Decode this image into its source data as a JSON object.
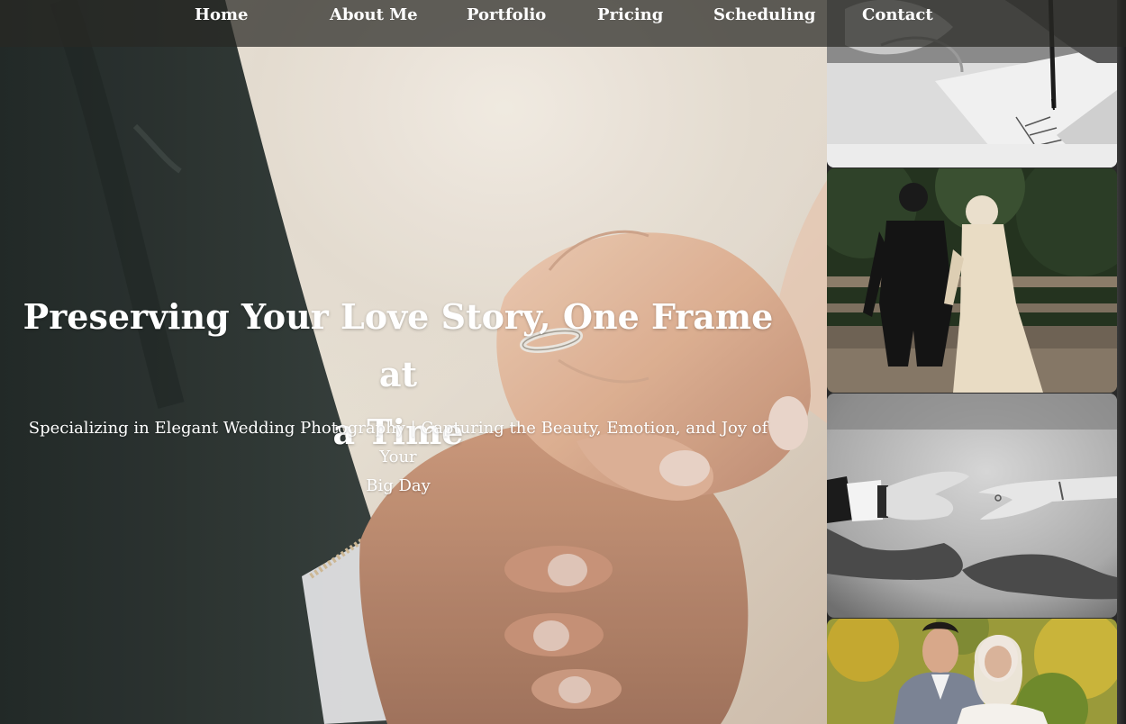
{
  "nav": {
    "items": [
      {
        "label": "Home"
      },
      {
        "label": "About Me"
      },
      {
        "label": "Portfolio"
      },
      {
        "label": "Pricing"
      },
      {
        "label": "Scheduling"
      },
      {
        "label": "Contact"
      }
    ]
  },
  "hero": {
    "title_line1": "Preserving Your Love Story, One Frame at",
    "title_line2": "a Time",
    "subtitle_line1": "Specializing in Elegant Wedding Photography | Capturing the Beauty, Emotion, and Joy of Your",
    "subtitle_line2": "Big Day"
  },
  "gallery": {
    "photos": [
      {
        "subject": "hand writing in notebook (black and white)"
      },
      {
        "subject": "couple walking in forest"
      },
      {
        "subject": "reaching hands with shadows (black and white)"
      },
      {
        "subject": "smiling couple portrait outdoors"
      }
    ]
  },
  "colors": {
    "nav_bg": "#282824",
    "text": "#ffffff",
    "hero_light": "#ece6dc"
  }
}
